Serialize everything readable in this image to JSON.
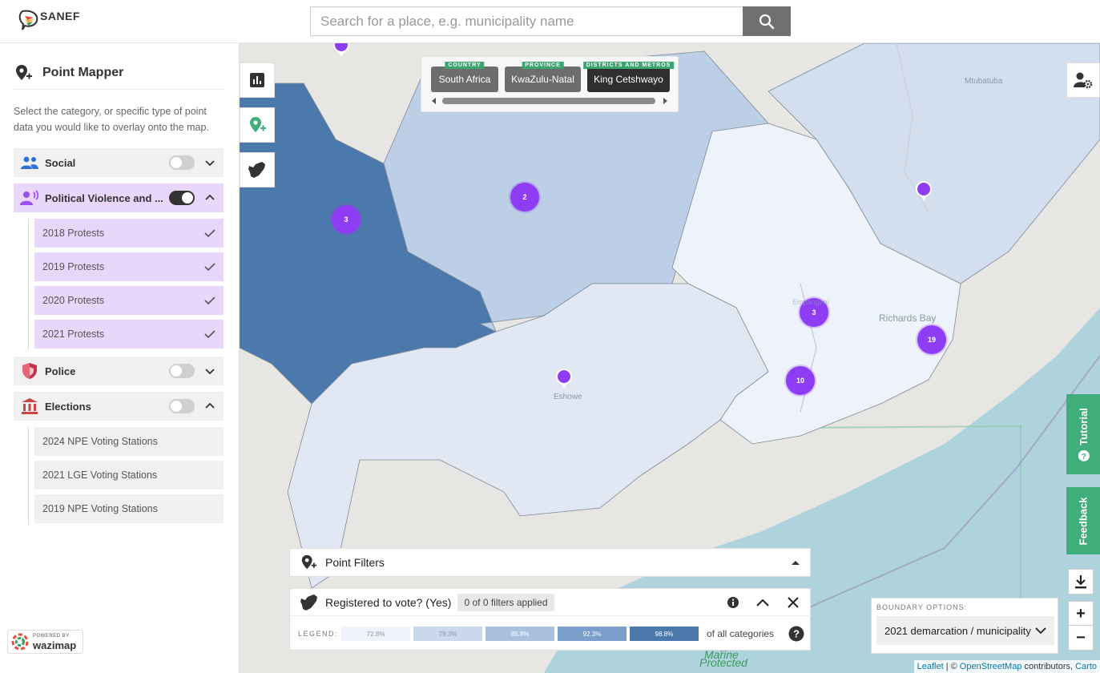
{
  "header": {
    "logo_text": "SANEF",
    "search_placeholder": "Search for a place, e.g. municipality name"
  },
  "sidebar": {
    "title": "Point Mapper",
    "description": "Select the category, or specific type of point data you would like to overlay onto the map.",
    "categories": [
      {
        "label": "Social",
        "on": false,
        "expanded": false
      },
      {
        "label": "Political Violence and ...",
        "on": true,
        "expanded": true
      },
      {
        "label": "Police",
        "on": false,
        "expanded": false
      },
      {
        "label": "Elections",
        "on": false,
        "expanded": true
      }
    ],
    "political_items": [
      "2018 Protests",
      "2019 Protests",
      "2020 Protests",
      "2021 Protests"
    ],
    "election_items": [
      "2024 NPE Voting Stations",
      "2021 LGE Voting Stations",
      "2019 NPE Voting Stations"
    ],
    "powered_small": "POWERED BY",
    "powered_big": "wazimap"
  },
  "breadcrumbs": [
    {
      "tag": "COUNTRY",
      "label": "South Africa"
    },
    {
      "tag": "PROVINCE",
      "label": "KwaZulu-Natal"
    },
    {
      "tag": "DISTRICTS AND METROS",
      "label": "King Cetshwayo"
    }
  ],
  "map": {
    "clusters": [
      "3",
      "2",
      "3",
      "19",
      "10"
    ],
    "labels": [
      "Richards Bay",
      "Mtubatuba",
      "Eshowe",
      "Empangeni"
    ],
    "sea_labels": [
      "Marine",
      "Protected"
    ]
  },
  "right_tabs": {
    "tutorial": "Tutorial",
    "feedback": "Feedback"
  },
  "zoom": {
    "in": "+",
    "out": "−"
  },
  "point_filters": {
    "title": "Point Filters"
  },
  "rich_data": {
    "title": "Registered to vote? (Yes)",
    "filters_badge": "0 of 0 filters applied",
    "legend_label": "LEGEND:",
    "legend": [
      "72.8%",
      "79.3%",
      "85.8%",
      "92.3%",
      "98.8%"
    ],
    "legend_colors": [
      "#eef3fa",
      "#c9d8eb",
      "#a9c1df",
      "#7a9fcb",
      "#4c79ab"
    ],
    "legend_suffix": "of all categories"
  },
  "boundary": {
    "label": "BOUNDARY OPTIONS:",
    "value": "2021 demarcation / municipality"
  },
  "attribution": {
    "leaflet": "Leaflet",
    "sep": " | © ",
    "osm": "OpenStreetMap",
    "contrib": " contributors, ",
    "carto": "Carto"
  },
  "colors": {
    "accent_purple": "#8f3cf5",
    "active_bg": "#e9d7fb",
    "green": "#3fae7a"
  }
}
